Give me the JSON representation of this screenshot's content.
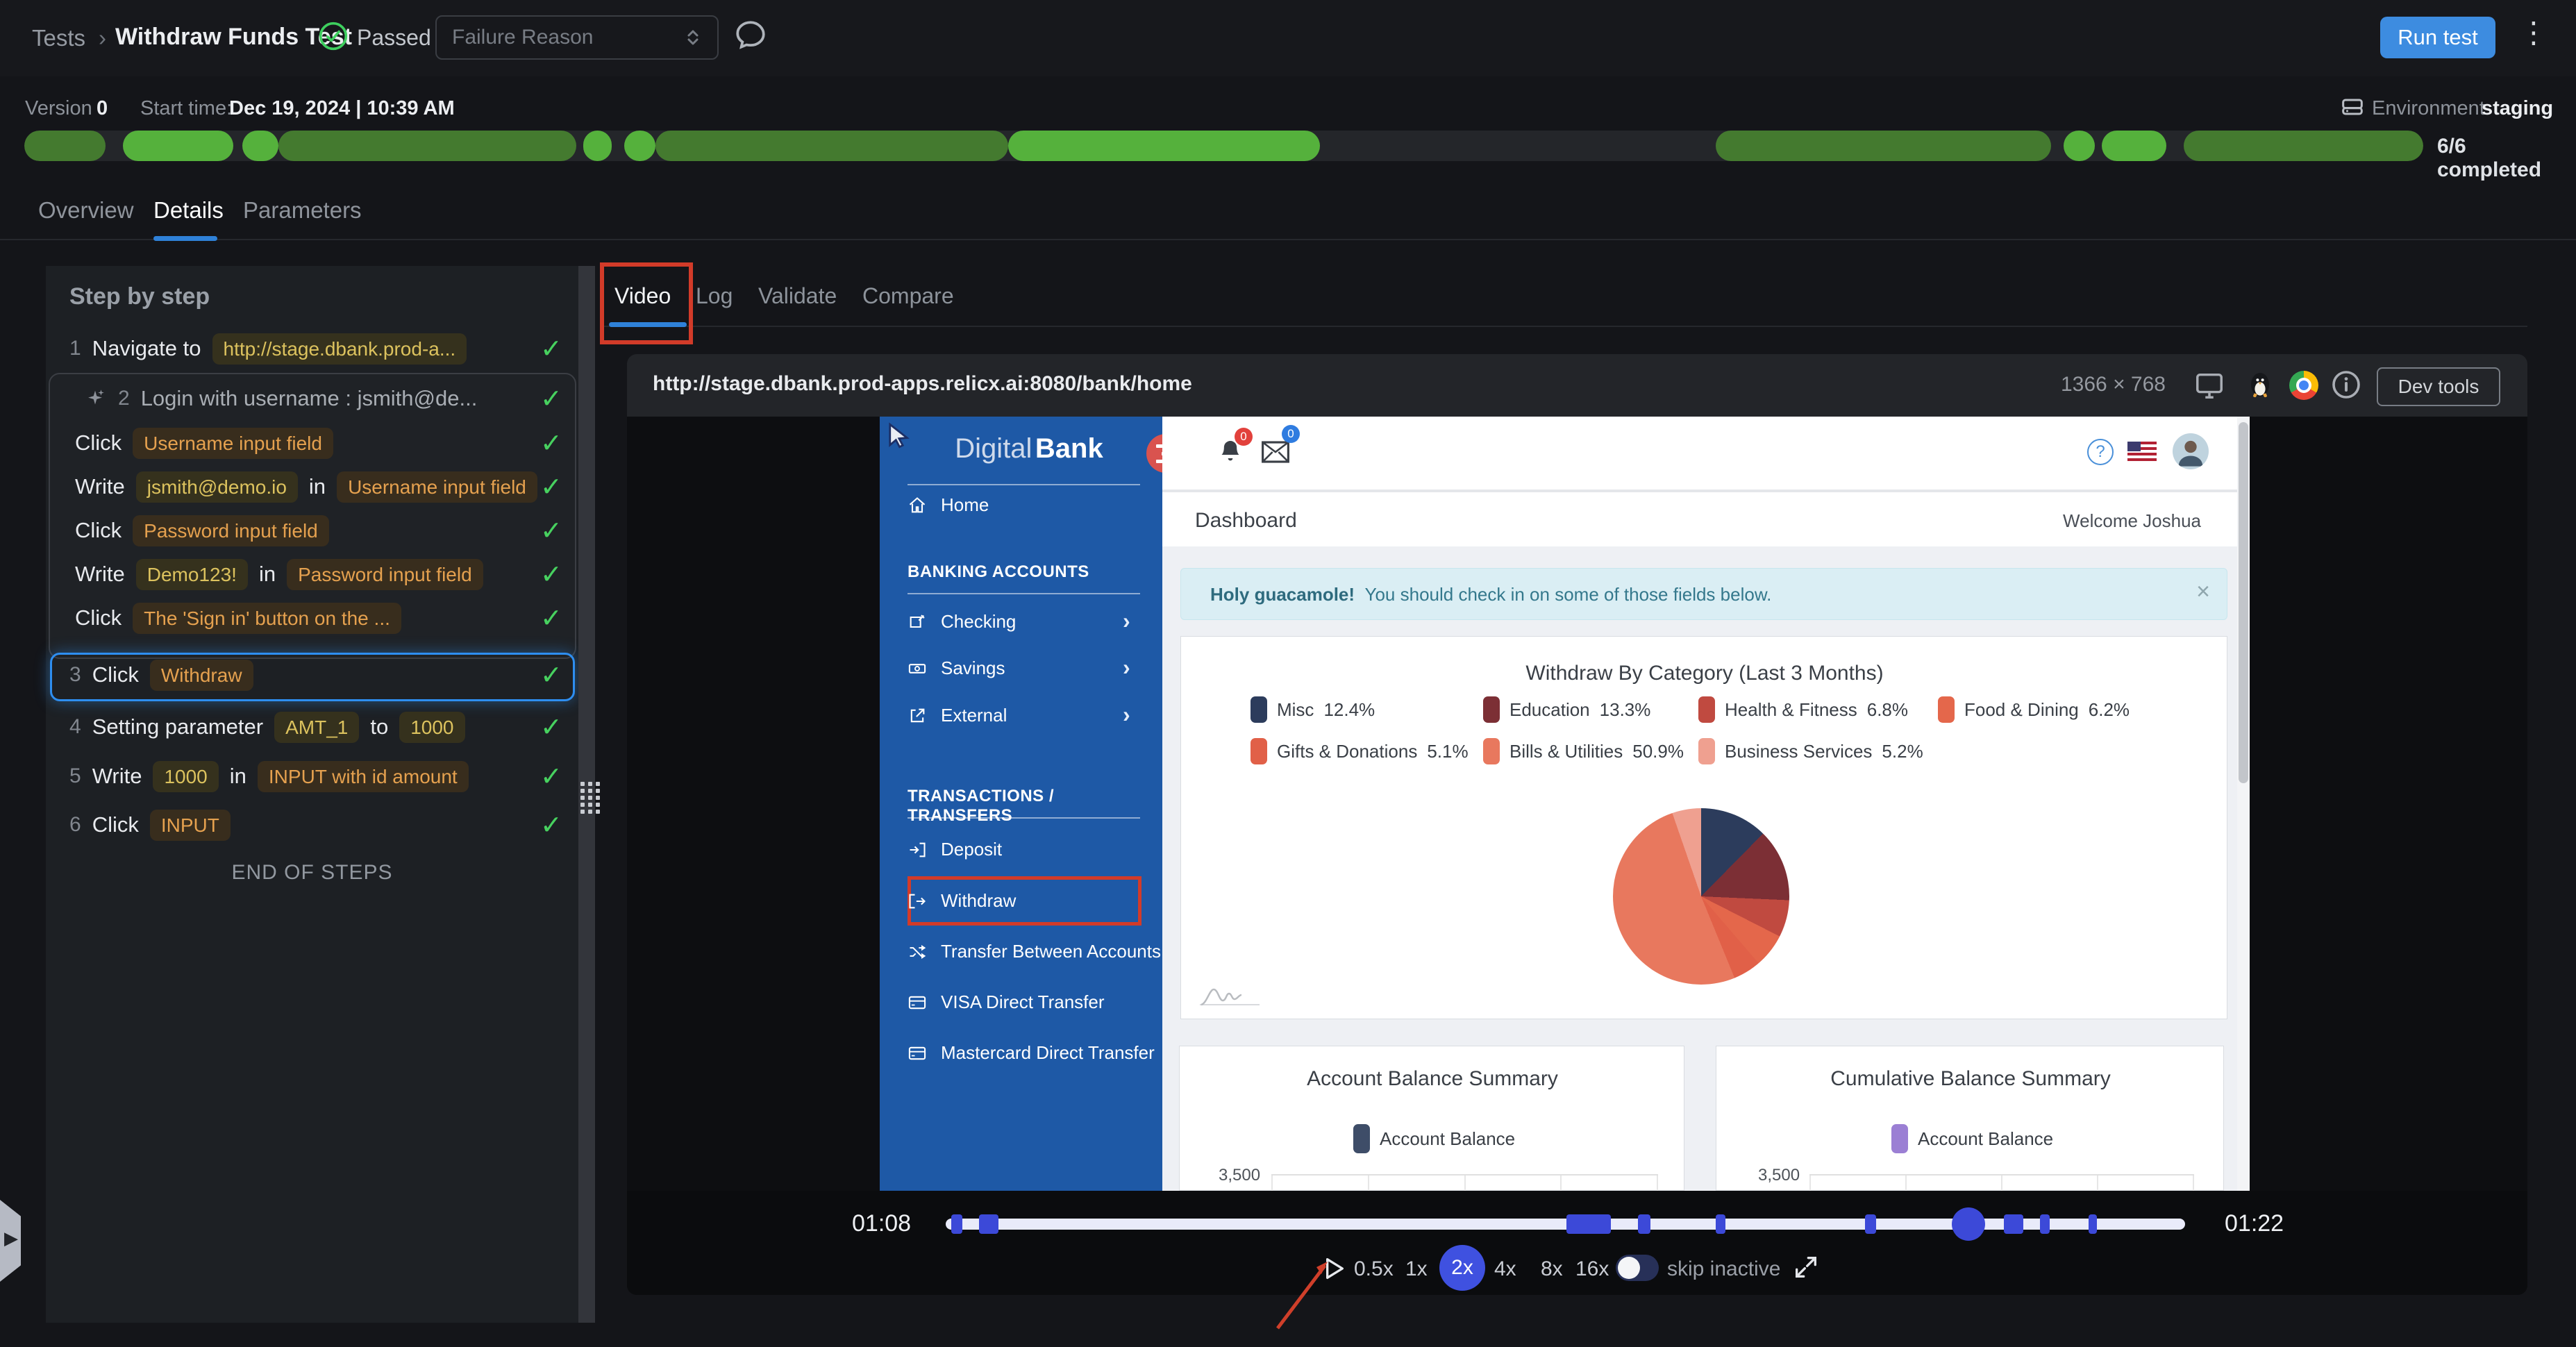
{
  "colors": {
    "accent_blue": "#3d8ce0",
    "tab_underline": "#2f81d8",
    "success_green": "#47d15f",
    "progress_dark_green": "#447a2f",
    "progress_bright_green": "#55b13c",
    "badge_yellow": "#dcc25e",
    "badge_orange": "#e5a14f",
    "selected_step_border": "#2e8ef0",
    "annotation_red": "#d23b29",
    "player_accent": "#3c49d8",
    "bank_sidebar_blue": "#1e59a6",
    "bank_hamburger_red": "#d9534f",
    "alert_bg": "#daeef4",
    "alert_text": "#2e6b7e",
    "pie_colors": [
      "#2c3c5c",
      "#7c2f35",
      "#c04a40",
      "#e4674b",
      "#e16048",
      "#e8785e",
      "#efa090"
    ],
    "balance_navy": "#3e4d68",
    "balance_purple": "#9b7fd4"
  },
  "header": {
    "breadcrumb": "Tests",
    "separator": "›",
    "title": "Withdraw Funds Test",
    "status": "Passed",
    "failure_reason_placeholder": "Failure Reason",
    "run_test": "Run test"
  },
  "meta": {
    "version_label": "Version",
    "version_value": "0",
    "start_label": "Start time:",
    "start_value": "Dec 19, 2024 | 10:39 AM",
    "environment_label": "Environment",
    "environment_value": "staging",
    "completed": "6/6 completed"
  },
  "tabs": {
    "overview": "Overview",
    "details": "Details",
    "parameters": "Parameters"
  },
  "steps_panel": {
    "title": "Step by step",
    "end_of_steps": "END OF STEPS",
    "step1": {
      "num": "1",
      "action": "Navigate to",
      "target": "http://stage.dbank.prod-a..."
    },
    "group": {
      "num": "2",
      "label": "Login with username : jsmith@de..."
    },
    "g1": {
      "action": "Click",
      "target": "Username input field"
    },
    "g2": {
      "action": "Write",
      "value": "jsmith@demo.io",
      "conj": "in",
      "target": "Username input field"
    },
    "g3": {
      "action": "Click",
      "target": "Password input field"
    },
    "g4": {
      "action": "Write",
      "value": "Demo123!",
      "conj": "in",
      "target": "Password input field"
    },
    "g5": {
      "action": "Click",
      "target": "The 'Sign in' button on the ..."
    },
    "step3": {
      "num": "3",
      "action": "Click",
      "target": "Withdraw"
    },
    "step4": {
      "num": "4",
      "action": "Setting parameter",
      "param": "AMT_1",
      "conj": "to",
      "value": "1000"
    },
    "step5": {
      "num": "5",
      "action": "Write",
      "value": "1000",
      "conj": "in",
      "target": "INPUT with id amount"
    },
    "step6": {
      "num": "6",
      "action": "Click",
      "target": "INPUT"
    }
  },
  "result_tabs": {
    "video": "Video",
    "log": "Log",
    "validate": "Validate",
    "compare": "Compare"
  },
  "player": {
    "url": "http://stage.dbank.prod-apps.relicx.ai:8080/bank/home",
    "resolution": "1366 × 768",
    "devtools": "Dev tools",
    "time_current": "01:08",
    "time_total": "01:22",
    "speed_05": "0.5x",
    "speed_1": "1x",
    "speed_2": "2x",
    "speed_4": "4x",
    "speed_8": "8x",
    "speed_16": "16x",
    "selected_speed": "2x",
    "skip_inactive_label": "skip inactive",
    "timeline_marker_pcts": [
      0.5,
      2.9,
      50.1,
      55.9,
      62.1,
      74.2,
      85.4,
      88.3,
      92.2
    ],
    "thumb_pct": 82.5
  },
  "bank": {
    "brand_light": "Digital",
    "brand_bold": "Bank",
    "nav_home": "Home",
    "section_accounts": "BANKING ACCOUNTS",
    "nav_checking": "Checking",
    "nav_savings": "Savings",
    "nav_external": "External",
    "section_transactions": "TRANSACTIONS / TRANSFERS",
    "nav_deposit": "Deposit",
    "nav_withdraw": "Withdraw",
    "nav_transfer": "Transfer Between Accounts",
    "nav_visa": "VISA Direct Transfer",
    "nav_mastercard": "Mastercard Direct Transfer",
    "bell_badge": "0",
    "mail_badge": "0",
    "help": "?",
    "page_title": "Dashboard",
    "welcome": "Welcome Joshua",
    "alert_bold": "Holy guacamole!",
    "alert_text": "You should check in on some of those fields below.",
    "alert_close": "×",
    "pie_card_title": "Withdraw By Category (Last 3 Months)",
    "legend": {
      "misc": "Misc",
      "misc_pct": "12.4%",
      "education": "Education",
      "education_pct": "13.3%",
      "health": "Health & Fitness",
      "health_pct": "6.8%",
      "food": "Food & Dining",
      "food_pct": "6.2%",
      "gifts": "Gifts & Donations",
      "gifts_pct": "5.1%",
      "bills": "Bills & Utilities",
      "bills_pct": "50.9%",
      "business": "Business Services",
      "business_pct": "5.2%"
    },
    "card_account_title": "Account Balance Summary",
    "card_cumulative_title": "Cumulative Balance Summary",
    "balance_legend": "Account Balance",
    "axis_top_tick": "3,500"
  },
  "chart_data": [
    {
      "type": "pie",
      "title": "Withdraw By Category (Last 3 Months)",
      "labels": [
        "Misc",
        "Education",
        "Health & Fitness",
        "Food & Dining",
        "Gifts & Donations",
        "Bills & Utilities",
        "Business Services"
      ],
      "values": [
        12.4,
        13.3,
        6.8,
        6.2,
        5.1,
        50.9,
        5.2
      ],
      "colors": [
        "#2c3c5c",
        "#7c2f35",
        "#c04a40",
        "#e4674b",
        "#e16048",
        "#e8785e",
        "#efa090"
      ],
      "legend_position": "top"
    },
    {
      "type": "bar",
      "title": "Account Balance Summary",
      "series": [
        {
          "name": "Account Balance"
        }
      ],
      "y_top_tick": 3500,
      "color": "#3e4d68",
      "note_visible_portion": "only top gridline at 3,500 visible in video crop"
    },
    {
      "type": "bar",
      "title": "Cumulative Balance Summary",
      "series": [
        {
          "name": "Account Balance"
        }
      ],
      "y_top_tick": 3500,
      "color": "#9b7fd4",
      "note_visible_portion": "only top gridline at 3,500 visible in video crop"
    }
  ]
}
